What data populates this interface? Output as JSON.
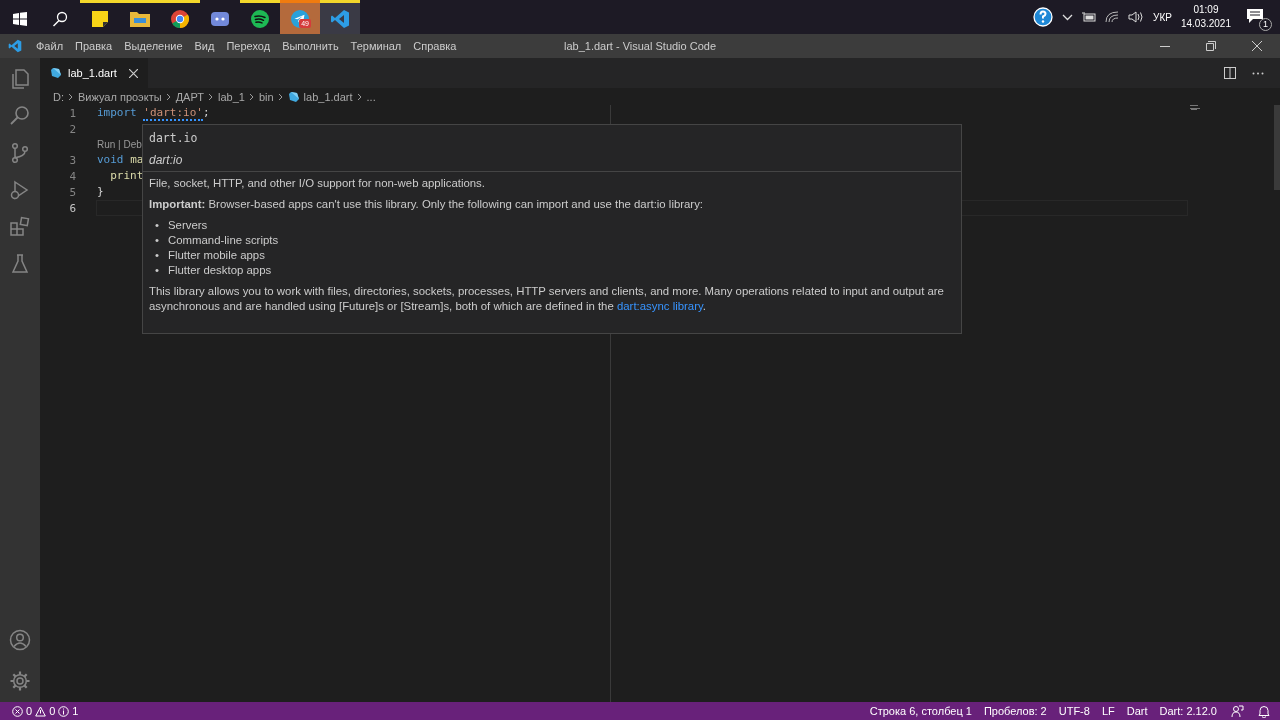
{
  "taskbar": {
    "apps": [
      {
        "kind": "sticky-notes",
        "open": true,
        "selected": false
      },
      {
        "kind": "folder",
        "open": true,
        "selected": false
      },
      {
        "kind": "chrome",
        "open": true,
        "selected": false
      },
      {
        "kind": "discord",
        "open": false,
        "selected": false
      },
      {
        "kind": "spotify",
        "open": true,
        "selected": false
      },
      {
        "kind": "telegram",
        "open": true,
        "selected": false,
        "flashing": true,
        "badge": "49"
      },
      {
        "kind": "vscode",
        "open": true,
        "selected": true
      }
    ],
    "tray": {
      "language": "УКР",
      "time": "01:09",
      "date": "14.03.2021",
      "notifications": "1"
    }
  },
  "menu": [
    "Файл",
    "Правка",
    "Выделение",
    "Вид",
    "Переход",
    "Выполнить",
    "Терминал",
    "Справка"
  ],
  "window": {
    "title": "lab_1.dart - Visual Studio Code"
  },
  "activity_bar": [
    {
      "kind": "files"
    },
    {
      "kind": "search"
    },
    {
      "kind": "source-control"
    },
    {
      "kind": "run"
    },
    {
      "kind": "extensions"
    },
    {
      "kind": "testing"
    }
  ],
  "activity_bar_bottom": [
    {
      "kind": "account"
    },
    {
      "kind": "settings"
    }
  ],
  "tabs": [
    {
      "label": "lab_1.dart",
      "selected": true
    }
  ],
  "breadcrumb": [
    "D:",
    "Вижуал проэкты",
    "ДАРТ",
    "lab_1",
    "bin",
    "lab_1.dart",
    "..."
  ],
  "editor": {
    "lines": [
      {
        "number": "1",
        "current": false,
        "tokens": [
          {
            "text": "import ",
            "kind": "keyword",
            "squiggle": false
          },
          {
            "text": "'dart:io'",
            "kind": "string",
            "squiggle": true
          },
          {
            "text": ";",
            "kind": "plain",
            "squiggle": false
          }
        ]
      },
      {
        "number": "2",
        "current": false
      },
      {
        "number": "3",
        "current": false,
        "codelens": "Run | Deb",
        "tokens": [
          {
            "text": "void ",
            "kind": "keyword"
          },
          {
            "text": "ma",
            "kind": "function"
          }
        ]
      },
      {
        "number": "4",
        "current": false,
        "tokens": [
          {
            "text": "  print",
            "kind": "function"
          }
        ]
      },
      {
        "number": "5",
        "current": false,
        "tokens": [
          {
            "text": "}",
            "kind": "plain"
          }
        ]
      },
      {
        "number": "6",
        "current": true
      }
    ]
  },
  "hover": {
    "signature": "dart.io",
    "library": "dart:io",
    "summary": "File, socket, HTTP, and other I/O support for non-web applications.",
    "important": "**Important:** Browser-based apps can't use this library. Only the following can import and use the dart:io library:",
    "bullet_marker": "•",
    "bullets": [
      "Servers",
      "Command-line scripts",
      "Flutter mobile apps",
      "Flutter desktop apps"
    ],
    "details": {
      "text": "This library allows you to work with files, directories, sockets, processes, HTTP servers and clients, and more. Many operations related to input and output are asynchronous and are handled using [Future]s or [Stream]s, both of which are defined in the ",
      "link": "dart:async library",
      "after": "."
    }
  },
  "status_bar": {
    "errors": "0",
    "warnings": "0",
    "infos": "1",
    "items": [
      "Строка 6, столбец 1",
      "Пробелов: 2",
      "UTF-8",
      "LF",
      "Dart",
      "Dart: 2.12.0"
    ]
  }
}
